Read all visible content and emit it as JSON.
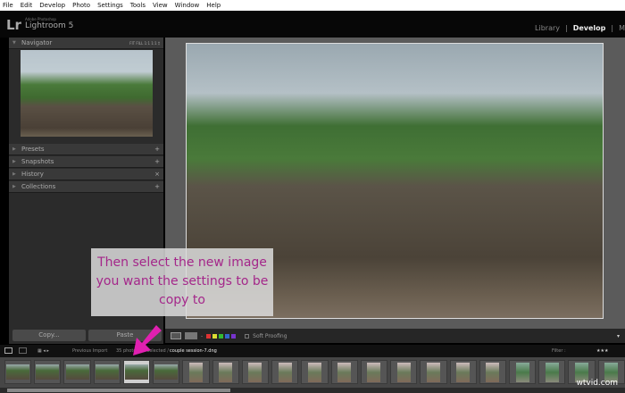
{
  "menu": [
    "File",
    "Edit",
    "Develop",
    "Photo",
    "Settings",
    "Tools",
    "View",
    "Window",
    "Help"
  ],
  "app": {
    "logo": "Lr",
    "vendor": "Adobe Photoshop",
    "name": "Lightroom 5"
  },
  "modules": [
    "Library",
    "Develop",
    "M"
  ],
  "navigator": {
    "title": "Navigator",
    "zoom": "FIT  FILL  1:1  1:1 ‡"
  },
  "panels": [
    {
      "label": "Presets",
      "action": "+"
    },
    {
      "label": "Snapshots",
      "action": "+"
    },
    {
      "label": "History",
      "action": "×"
    },
    {
      "label": "Collections",
      "action": "+"
    }
  ],
  "buttons": {
    "copy": "Copy...",
    "paste": "Paste"
  },
  "toolbar": {
    "soft_proofing": "Soft Proofing",
    "labels": [
      "#d33",
      "#dd3",
      "#3b3",
      "#36c",
      "#73c"
    ]
  },
  "filmstrip": {
    "source": "Previous Import",
    "count": "35 photos / 1 selected /",
    "file": "couple session-7.dng",
    "filter": "Filter :"
  },
  "annotation": "Then select the new image you want the settings to be copy to",
  "watermark": "wtvid.com"
}
